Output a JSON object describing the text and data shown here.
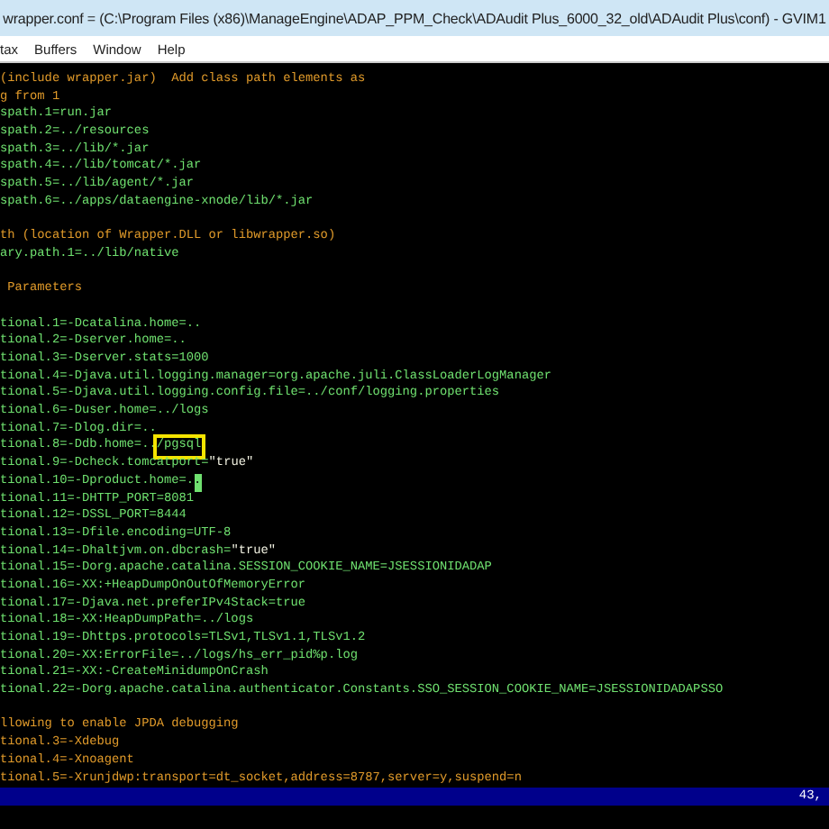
{
  "window": {
    "title": "wrapper.conf = (C:\\Program Files (x86)\\ManageEngine\\ADAP_PPM_Check\\ADAudit Plus_6000_32_old\\ADAudit Plus\\conf) - GVIM1"
  },
  "menu": [
    "tax",
    "Buffers",
    "Window",
    "Help"
  ],
  "lines": [
    {
      "kind": "comment",
      "segments": [
        {
          "kind": "text",
          "text": "(include wrapper.jar)  Add class path elements as"
        }
      ]
    },
    {
      "kind": "comment",
      "segments": [
        {
          "kind": "text",
          "text": "g from 1"
        }
      ]
    },
    {
      "kind": "setting",
      "segments": [
        {
          "kind": "text",
          "text": "spath.1=run.jar"
        }
      ]
    },
    {
      "kind": "setting",
      "segments": [
        {
          "kind": "text",
          "text": "spath.2=../resources"
        }
      ]
    },
    {
      "kind": "setting",
      "segments": [
        {
          "kind": "text",
          "text": "spath.3=../lib/*.jar"
        }
      ]
    },
    {
      "kind": "setting",
      "segments": [
        {
          "kind": "text",
          "text": "spath.4=../lib/tomcat/*.jar"
        }
      ]
    },
    {
      "kind": "setting",
      "segments": [
        {
          "kind": "text",
          "text": "spath.5=../lib/agent/*.jar"
        }
      ]
    },
    {
      "kind": "setting",
      "segments": [
        {
          "kind": "text",
          "text": "spath.6=../apps/dataengine-xnode/lib/*.jar"
        }
      ]
    },
    {
      "kind": "blank"
    },
    {
      "kind": "comment",
      "segments": [
        {
          "kind": "text",
          "text": "th (location of Wrapper.DLL or libwrapper.so)"
        }
      ]
    },
    {
      "kind": "setting",
      "segments": [
        {
          "kind": "text",
          "text": "ary.path.1=../lib/native"
        }
      ]
    },
    {
      "kind": "blank"
    },
    {
      "kind": "comment",
      "segments": [
        {
          "kind": "text",
          "text": " Parameters"
        }
      ]
    },
    {
      "kind": "blank"
    },
    {
      "kind": "setting",
      "segments": [
        {
          "kind": "text",
          "text": "tional.1=-Dcatalina.home=.."
        }
      ]
    },
    {
      "kind": "setting",
      "segments": [
        {
          "kind": "text",
          "text": "tional.2=-Dserver.home=.."
        }
      ]
    },
    {
      "kind": "setting",
      "segments": [
        {
          "kind": "text",
          "text": "tional.3=-Dserver.stats=1000"
        }
      ]
    },
    {
      "kind": "setting",
      "segments": [
        {
          "kind": "text",
          "text": "tional.4=-Djava.util.logging.manager=org.apache.juli.ClassLoaderLogManager"
        }
      ]
    },
    {
      "kind": "setting",
      "segments": [
        {
          "kind": "text",
          "text": "tional.5=-Djava.util.logging.config.file=../conf/logging.properties"
        }
      ]
    },
    {
      "kind": "setting",
      "segments": [
        {
          "kind": "text",
          "text": "tional.6=-Duser.home=../logs"
        }
      ]
    },
    {
      "kind": "setting",
      "segments": [
        {
          "kind": "text",
          "text": "tional.7=-Dlog.dir=.."
        }
      ]
    },
    {
      "kind": "setting",
      "segments": [
        {
          "kind": "text",
          "text": "tional.8=-Ddb.home=.."
        },
        {
          "kind": "boxed",
          "text": "/pgsql"
        }
      ]
    },
    {
      "kind": "setting",
      "segments": [
        {
          "kind": "text",
          "text": "tional.9=-Dcheck.tomcatport="
        },
        {
          "kind": "string",
          "text": "\"true\""
        }
      ]
    },
    {
      "kind": "setting",
      "segments": [
        {
          "kind": "text",
          "text": "tional.10=-Dproduct.home=."
        },
        {
          "kind": "cursor",
          "text": "."
        }
      ]
    },
    {
      "kind": "setting",
      "segments": [
        {
          "kind": "text",
          "text": "tional.11=-DHTTP_PORT=8081"
        }
      ]
    },
    {
      "kind": "setting",
      "segments": [
        {
          "kind": "text",
          "text": "tional.12=-DSSL_PORT=8444"
        }
      ]
    },
    {
      "kind": "setting",
      "segments": [
        {
          "kind": "text",
          "text": "tional.13=-Dfile.encoding=UTF-8"
        }
      ]
    },
    {
      "kind": "setting",
      "segments": [
        {
          "kind": "text",
          "text": "tional.14=-Dhaltjvm.on.dbcrash="
        },
        {
          "kind": "string",
          "text": "\"true\""
        }
      ]
    },
    {
      "kind": "setting",
      "segments": [
        {
          "kind": "text",
          "text": "tional.15=-Dorg.apache.catalina.SESSION_COOKIE_NAME=JSESSIONIDADAP"
        }
      ]
    },
    {
      "kind": "setting",
      "segments": [
        {
          "kind": "text",
          "text": "tional.16=-XX:+HeapDumpOnOutOfMemoryError"
        }
      ]
    },
    {
      "kind": "setting",
      "segments": [
        {
          "kind": "text",
          "text": "tional.17=-Djava.net.preferIPv4Stack=true"
        }
      ]
    },
    {
      "kind": "setting",
      "segments": [
        {
          "kind": "text",
          "text": "tional.18=-XX:HeapDumpPath=../logs"
        }
      ]
    },
    {
      "kind": "setting",
      "segments": [
        {
          "kind": "text",
          "text": "tional.19=-Dhttps.protocols=TLSv1,TLSv1.1,TLSv1.2"
        }
      ]
    },
    {
      "kind": "setting",
      "segments": [
        {
          "kind": "text",
          "text": "tional.20=-XX:ErrorFile=../logs/hs_err_pid%p.log"
        }
      ]
    },
    {
      "kind": "setting",
      "segments": [
        {
          "kind": "text",
          "text": "tional.21=-XX:-CreateMinidumpOnCrash"
        }
      ]
    },
    {
      "kind": "setting",
      "segments": [
        {
          "kind": "text",
          "text": "tional.22=-Dorg.apache.catalina.authenticator.Constants.SSO_SESSION_COOKIE_NAME=JSESSIONIDADAPSSO"
        }
      ]
    },
    {
      "kind": "blank"
    },
    {
      "kind": "comment",
      "segments": [
        {
          "kind": "text",
          "text": "llowing to enable JPDA debugging"
        }
      ]
    },
    {
      "kind": "comment",
      "segments": [
        {
          "kind": "text",
          "text": "tional.3=-Xdebug"
        }
      ]
    },
    {
      "kind": "comment",
      "segments": [
        {
          "kind": "text",
          "text": "tional.4=-Xnoagent"
        }
      ]
    },
    {
      "kind": "comment",
      "segments": [
        {
          "kind": "text",
          "text": "tional.5=-Xrunjdwp:transport=dt_socket,address=8787,server=y,suspend=n"
        }
      ]
    }
  ],
  "status_bar": {
    "ruler": "43,"
  }
}
